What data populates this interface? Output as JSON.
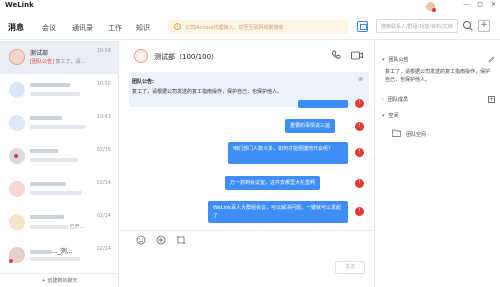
{
  "app": {
    "title": "WeLink",
    "window_controls": [
      "—",
      "□",
      "✕"
    ]
  },
  "nav": {
    "tabs": [
      {
        "label": "消息",
        "active": true
      },
      {
        "label": "会议",
        "active": false
      },
      {
        "label": "通讯录",
        "active": false
      },
      {
        "label": "工作",
        "active": false
      },
      {
        "label": "知识",
        "active": false
      }
    ],
    "notice_text": "公司iAccess代理接入，切至互联网频繁接收",
    "search_placeholder": "搜索联系人/群组/功能/资料/文档"
  },
  "conversations": [
    {
      "name": "测试部",
      "sub_tag": "[团队公告]",
      "sub_text": "复工了，请...",
      "time": "10:58",
      "selected": true,
      "avatar_color": "#f3d6cc"
    },
    {
      "name": "",
      "sub_text": "",
      "time": "10:50",
      "avatar_color": "#d9e6f7"
    },
    {
      "name": "",
      "sub_text": "",
      "time": "10:43",
      "avatar_color": "#dce9f9"
    },
    {
      "name": "",
      "sub_text": "",
      "time": "02/15",
      "avatar_color": "#d9d9d9"
    },
    {
      "name": "",
      "sub_text": "",
      "time": "02/14",
      "avatar_color": "#f4d9d0"
    },
    {
      "name": "",
      "sub_text": "已开...",
      "time": "02/14",
      "avatar_color": "#f8e3c8"
    },
    {
      "name": "..._刘...",
      "sub_text": "",
      "time": "02/14",
      "avatar_color": "#e8cfc8"
    },
    {
      "name": "",
      "sub_text": "",
      "time": "02/14",
      "avatar_color": "#d3e3f5"
    }
  ],
  "new_chat_label": "+ 创建新的聊天",
  "chat": {
    "title": "测试部（100/100）",
    "announcement_title": "团队公告:",
    "announcement_text": "复工了，请根据公司发送的复工指南操作，保护自己，也保护他人。",
    "messages": [
      {
        "text": "重要的事情说三遍"
      },
      {
        "text": "咱们部门人数众多，如何才能便捷地开会呢？"
      },
      {
        "text": "万一抓到会议室，这件去哪里大礼堂啊"
      },
      {
        "text": "WeLink百人大群组会议，可以解决问题，一键就可以发起了"
      }
    ],
    "status_icon": "!",
    "send_label": "发送"
  },
  "right_panel": {
    "announcement_header": "团队公告",
    "announcement_body": "复工了，请根据公司发送的复工指南操作，保护自己，也保护他人。",
    "members_header": "团队成员",
    "space_header": "空间",
    "space_item": "团队空间"
  }
}
